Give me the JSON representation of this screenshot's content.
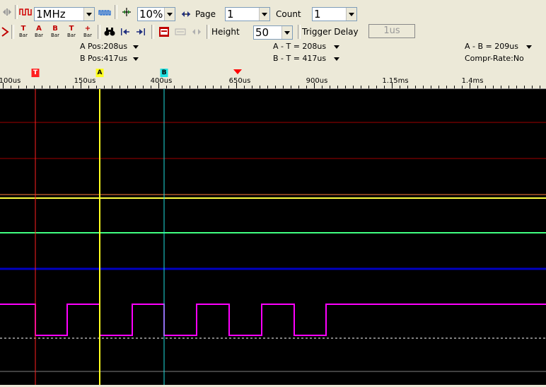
{
  "toolbar": {
    "frequency": "1MHz",
    "zoom": "10%",
    "page_label": "Page",
    "page_value": "1",
    "count_label": "Count",
    "count_value": "1",
    "height_label": "Height",
    "height_value": "50",
    "trigger_delay_label": "Trigger Delay",
    "trigger_delay_value": "1us",
    "bar_buttons": [
      {
        "big": "T",
        "small": "Bar",
        "color": "#c00000"
      },
      {
        "big": "A",
        "small": "Bar",
        "color": "#c00000"
      },
      {
        "big": "B",
        "small": "Bar",
        "color": "#c00000"
      },
      {
        "big": "T",
        "small": "Bar",
        "color": "#c00000"
      },
      {
        "big": "+",
        "small": "Bar",
        "color": "#c00000"
      }
    ],
    "icons": [
      "arrows-icon",
      "square-wave-red-icon",
      "square-wave-blue-icon",
      "zoom-fit-icon",
      "page-nav-icon",
      "cursor-icon",
      "binoculars-icon",
      "goto-start-icon",
      "goto-end-icon",
      "record-icon",
      "bus-icon",
      "compress-icon"
    ]
  },
  "info": {
    "a_pos": "A Pos:208us",
    "b_pos": "B Pos:417us",
    "a_minus_t": "A - T = 208us",
    "b_minus_t": "B - T = 417us",
    "a_minus_b": "A - B = 209us",
    "compr_rate": "Compr-Rate:No"
  },
  "ruler": {
    "labels": [
      "100us",
      "150us",
      "400us",
      "650us",
      "900us",
      "1.15ms",
      "1.4ms"
    ],
    "markers": {
      "t": "T",
      "a": "A",
      "b": "B"
    }
  },
  "colors": {
    "t_marker": "#ff0000",
    "a_marker": "#ffff00",
    "b_marker": "#00ffff",
    "trigger_arrow": "#ff0000",
    "channel_pink": "#ff00ff",
    "channel_blue": "#0000c0",
    "channel_green": "#40ff80",
    "channel_yellow": "#ffff40",
    "channel_orange": "#ff8040",
    "channel_red": "#a00000"
  },
  "waveform": {
    "pulse_transitions_us": [
      100,
      187,
      270,
      353,
      436,
      519,
      602,
      685,
      768,
      851
    ]
  }
}
